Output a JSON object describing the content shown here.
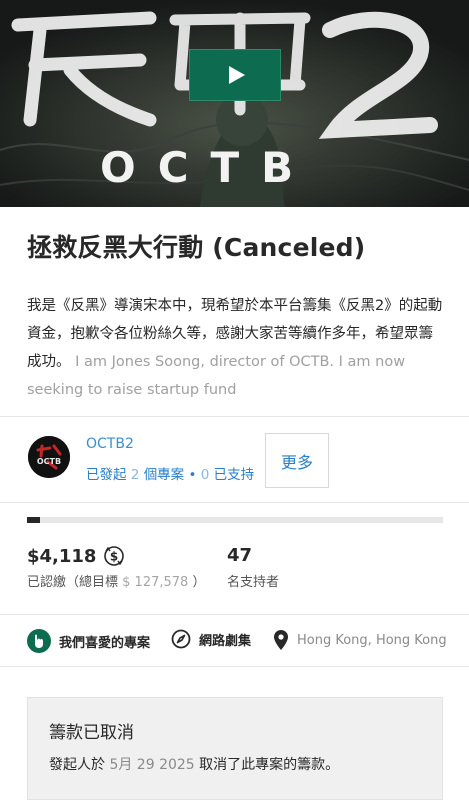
{
  "video": {
    "title_art": "反黑2",
    "subtitle_art": "OCTB",
    "play_icon": "play-icon"
  },
  "project": {
    "title": "拯救反黑大行動 (Canceled)",
    "blurb_zh": "我是《反黑》導演宋本中，現希望於本平台籌集《反黑2》的起動資金，抱歉令各位粉絲久等，感謝大家苦等續作多年，希望眾籌成功。",
    "blurb_en": "I am Jones Soong, director of OCTB. I am now seeking to raise startup fund"
  },
  "creator": {
    "name": "OCTB2",
    "launched_prefix": "已發起",
    "launched_count": "2",
    "launched_suffix": "個專案",
    "separator": "•",
    "backed_count": "0",
    "backed_label": "已支持",
    "more_label": "更多"
  },
  "funding": {
    "progress_fraction": 0.032,
    "pledged": "$4,118",
    "pledged_label": "已認繳（總目標",
    "goal": "$ 127,578",
    "pledged_label_end": "）",
    "backers": "47",
    "backers_label": "名支持者"
  },
  "tags": {
    "favorite": "我們喜愛的專案",
    "category": "網路劇集",
    "location": "Hong Kong, Hong Kong"
  },
  "status": {
    "title": "籌款已取消",
    "text_prefix": "發起人於",
    "date": "5月 29 2025",
    "text_suffix": "取消了此專案的籌款。"
  },
  "colors": {
    "accent_green": "#0d6b4f",
    "link_blue": "#2a7fc8",
    "text_dark": "#282828"
  }
}
